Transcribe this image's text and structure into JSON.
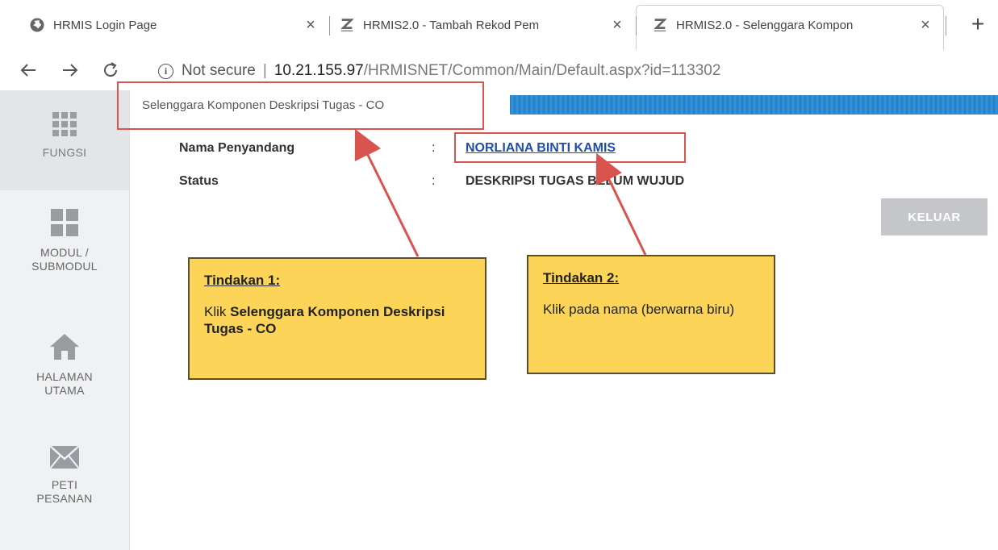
{
  "browser": {
    "tabs": [
      {
        "title": "HRMIS Login Page",
        "favicon": "globe-icon",
        "active": false
      },
      {
        "title": "HRMIS2.0 - Tambah Rekod Pem",
        "favicon": "hrmis-logo",
        "active": false
      },
      {
        "title": "HRMIS2.0 - Selenggara Kompon",
        "favicon": "hrmis-logo",
        "active": true
      }
    ],
    "close_glyph": "×",
    "new_tab_glyph": "+",
    "address": {
      "security_text": "Not secure",
      "host": "10.21.155.97",
      "path": "/HRMISNET/Common/Main/Default.aspx?id=113302"
    }
  },
  "sidebar": {
    "items": [
      {
        "label": "FUNGSI",
        "icon": "grid-icon",
        "active": true
      },
      {
        "label": "MODUL /\nSUBMODUL",
        "icon": "modules-icon",
        "active": false
      },
      {
        "label": "HALAMAN\nUTAMA",
        "icon": "home-icon",
        "active": false
      },
      {
        "label": "PETI\nPESANAN",
        "icon": "mail-icon",
        "active": false
      }
    ]
  },
  "page": {
    "title": "Selenggara Komponen Deskripsi Tugas - CO",
    "fields": [
      {
        "label": "Nama Penyandang",
        "colon": ":",
        "value": "NORLIANA BINTI KAMIS"
      },
      {
        "label": "Status",
        "colon": ":",
        "value": "DESKRIPSI TUGAS BELUM WUJUD"
      }
    ],
    "keluar_label": "KELUAR"
  },
  "annotations": [
    {
      "heading": "Tindakan 1:",
      "text_pre": "Klik ",
      "text_bold": "Selenggara Komponen Deskripsi Tugas - CO",
      "text_post": ""
    },
    {
      "heading": "Tindakan 2:",
      "text_pre": "Klik pada nama (berwarna biru)",
      "text_bold": "",
      "text_post": ""
    }
  ],
  "colors": {
    "link_blue": "#1f4fa8",
    "callout_yellow": "#fcd558",
    "highlight_red": "#d9534f",
    "title_strip_blue": "#1f7fc8"
  }
}
